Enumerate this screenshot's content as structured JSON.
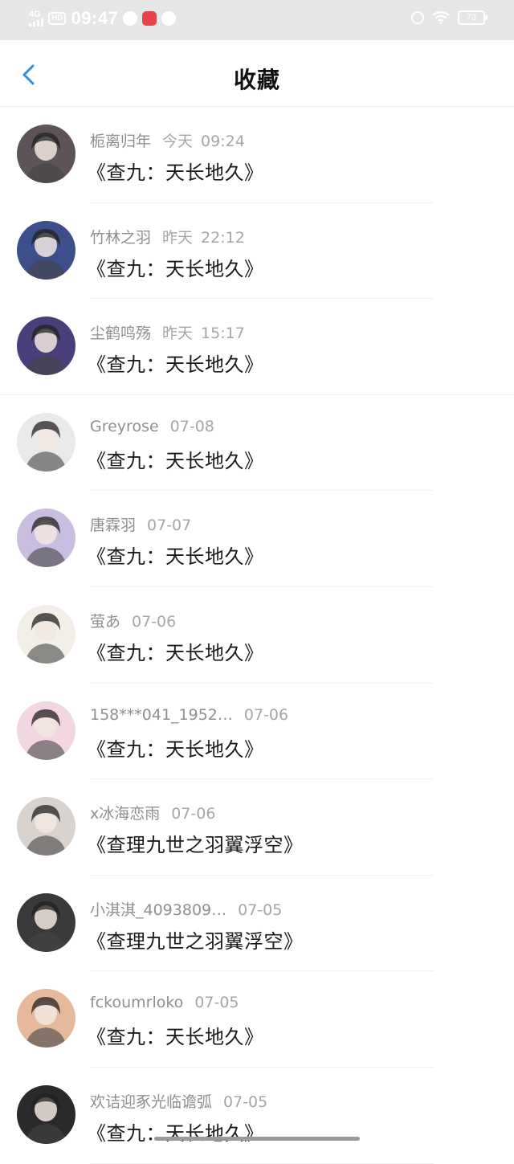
{
  "status_bar": {
    "network": "4G",
    "hd": "HD",
    "time": "09:47",
    "battery": "73"
  },
  "header": {
    "title": "收藏"
  },
  "items": [
    {
      "name": "栀离归年",
      "day": "今天",
      "time": "09:24",
      "post": "《查九：天长地久》",
      "avatar_bg": "#5d5359"
    },
    {
      "name": "竹林之羽",
      "day": "昨天",
      "time": "22:12",
      "post": "《查九：天长地久》",
      "avatar_bg": "#3d4f8a"
    },
    {
      "name": "尘鹤鸣殇",
      "day": "昨天",
      "time": "15:17",
      "post": "《查九：天长地久》",
      "avatar_bg": "#4a3f7a"
    },
    {
      "name": "Greyrose",
      "day": "",
      "time": "07-08",
      "post": "《查九：天长地久》",
      "avatar_bg": "#e9e9e9"
    },
    {
      "name": "唐霖羽",
      "day": "",
      "time": "07-07",
      "post": "《查九：天长地久》",
      "avatar_bg": "#c9bde0"
    },
    {
      "name": "萤あ",
      "day": "",
      "time": "07-06",
      "post": "《查九：天长地久》",
      "avatar_bg": "#f1efe8"
    },
    {
      "name": "158***041_1952…",
      "day": "",
      "time": "07-06",
      "post": "《查九：天长地久》",
      "avatar_bg": "#f2d7e3"
    },
    {
      "name": "x冰海恋雨",
      "day": "",
      "time": "07-06",
      "post": "《查理九世之羽翼浮空》",
      "avatar_bg": "#d9d3cf"
    },
    {
      "name": "小淇淇_4093809…",
      "day": "",
      "time": "07-05",
      "post": "《查理九世之羽翼浮空》",
      "avatar_bg": "#3a3a3a"
    },
    {
      "name": "fckoumrloko",
      "day": "",
      "time": "07-05",
      "post": "《查九：天长地久》",
      "avatar_bg": "#e6b89c"
    },
    {
      "name": "欢诘迎豖光临谵弧",
      "day": "",
      "time": "07-05",
      "post": "《查九：天长地久》",
      "avatar_bg": "#2a2a2a"
    }
  ],
  "colors": {
    "accent": "#2f8fe6",
    "status_bar_bg": "#e6e6e6"
  }
}
